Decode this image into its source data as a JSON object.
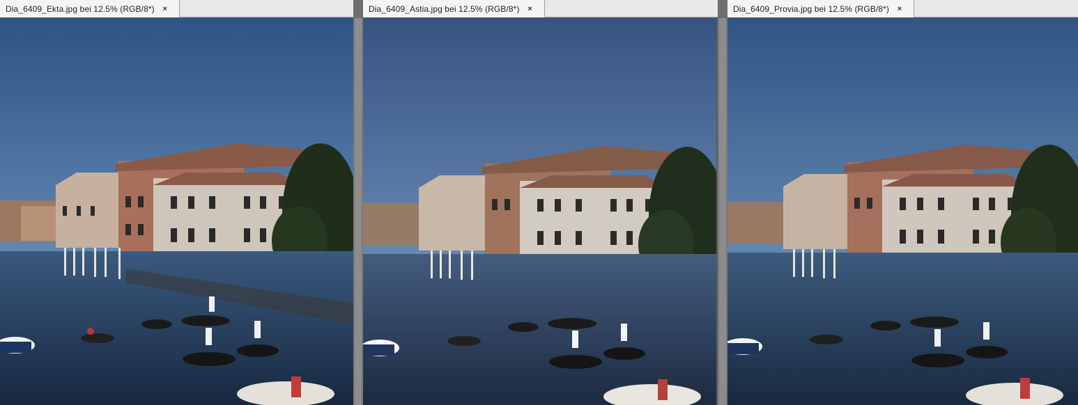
{
  "documents": [
    {
      "tab_title": "Dia_6409_Ekta.jpg bei 12.5% (RGB/8*)",
      "close_glyph": "×",
      "image_label": "Venice canal with gondolas"
    },
    {
      "tab_title": "Dia_6409_Astia.jpg bei 12.5% (RGB/8*)",
      "close_glyph": "×",
      "image_label": "Venice canal with gondolas"
    },
    {
      "tab_title": "Dia_6409_Provia.jpg bei 12.5% (RGB/8*)",
      "close_glyph": "×",
      "image_label": "Venice canal with gondolas"
    }
  ],
  "colors": {
    "tabbar_bg": "#e9e9e9",
    "workspace_bg": "#6e6e6e",
    "sky_top": "#2f5586",
    "sky_bottom": "#5a84ae",
    "water": "#1e3350"
  }
}
